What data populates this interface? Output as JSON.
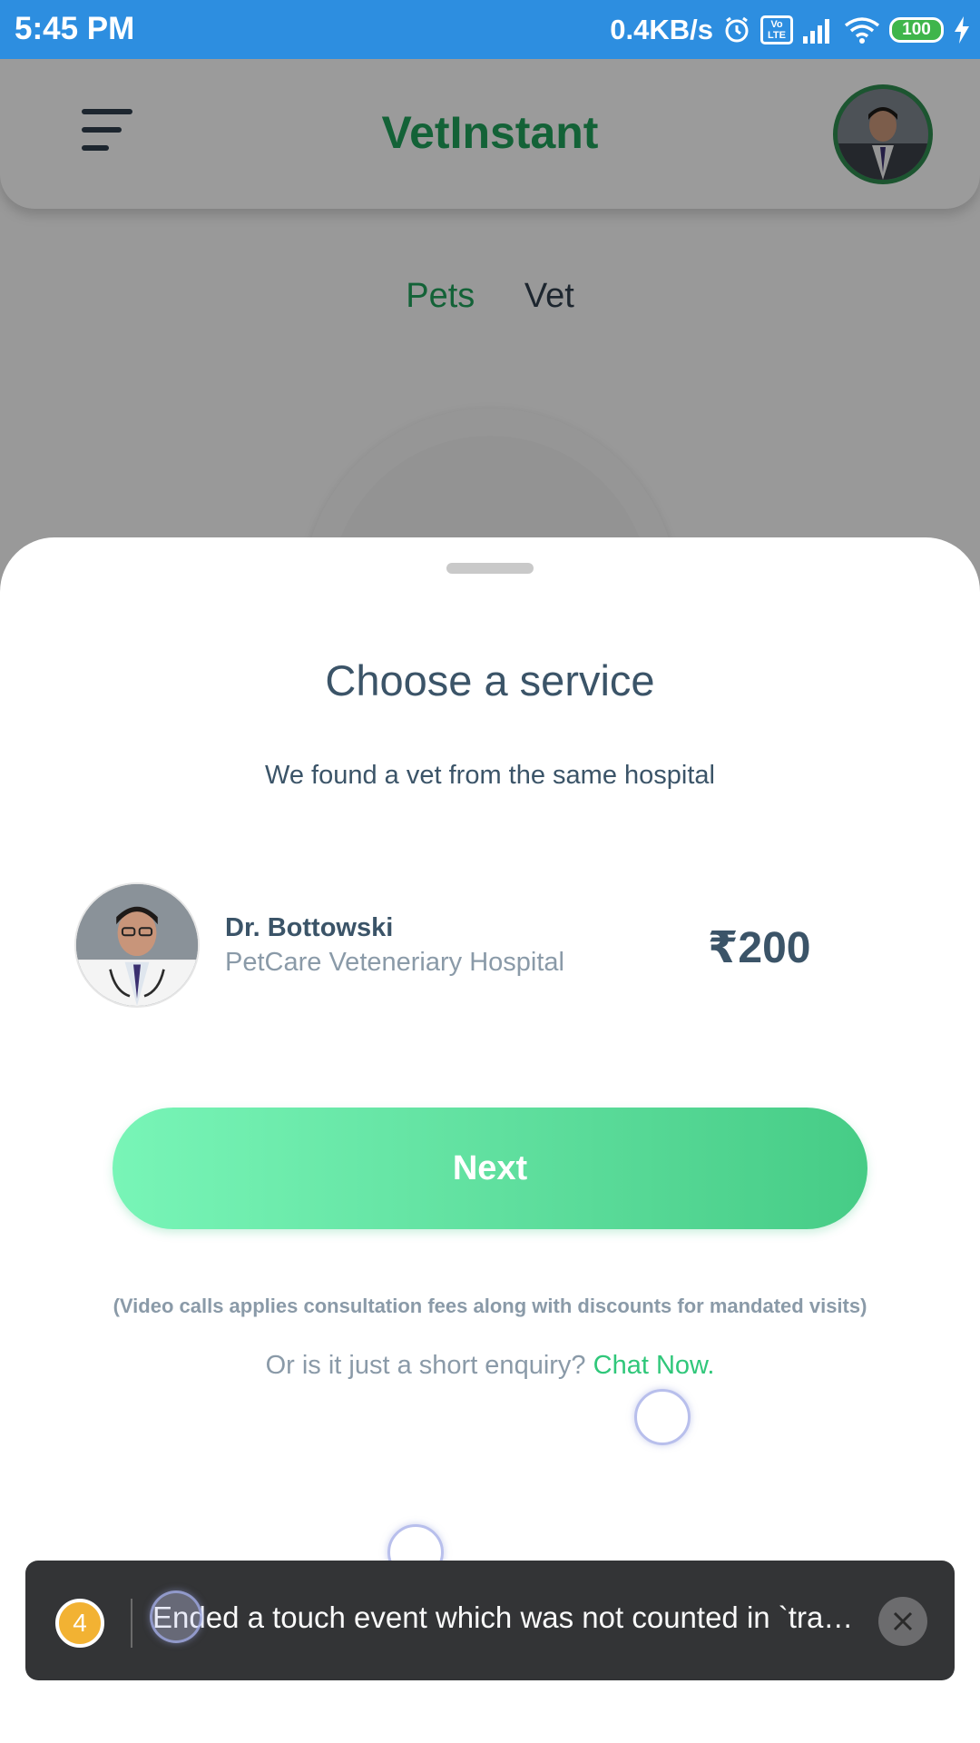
{
  "status_bar": {
    "time": "5:45 PM",
    "network_speed": "0.4KB/s",
    "volte_label": "Vo LTE",
    "battery_level": "100",
    "icons": [
      "alarm-icon",
      "volte-icon",
      "signal-icon",
      "wifi-icon",
      "battery-icon",
      "charging-icon"
    ]
  },
  "app_bar": {
    "title": "VetInstant",
    "menu_icon": "hamburger-menu-icon",
    "title_color": "#1f9f5a"
  },
  "tabs": [
    {
      "label": "Pets",
      "active": true
    },
    {
      "label": "Vet",
      "active": false
    }
  ],
  "sheet": {
    "title": "Choose a service",
    "subtitle": "We found a vet from the same hospital",
    "vet": {
      "name": "Dr. Bottowski",
      "hospital": "PetCare Veteneriary Hospital",
      "price": "₹200"
    },
    "next_label": "Next",
    "note": "(Video calls applies consultation fees along with discounts for mandated visits)",
    "enquiry_text": "Or is it just a short enquiry?",
    "chat_link": "Chat Now.",
    "accent_color": "#30c77a"
  },
  "toast": {
    "count": "4",
    "message": "Ended a touch event which was not counted in `tra…"
  }
}
